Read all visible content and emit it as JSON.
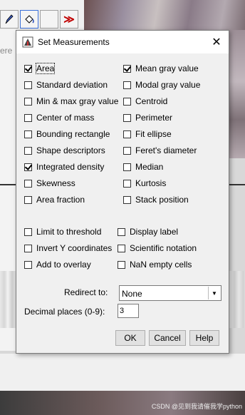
{
  "background": {
    "toolbar_tools": [
      {
        "icon": "pencil-icon"
      },
      {
        "icon": "bucket-icon"
      },
      {
        "icon": "blank-tool-icon"
      },
      {
        "icon": "double-chevron-right-icon",
        "label": "≫"
      }
    ],
    "left_partial_text": "ere ·",
    "watermark": "CSDN @见到我请催我学python"
  },
  "dialog": {
    "title": "Set Measurements",
    "close_glyph": "✕",
    "measurements_left": [
      {
        "label": "Area",
        "checked": true
      },
      {
        "label": "Standard deviation",
        "checked": false
      },
      {
        "label": "Min & max gray value",
        "checked": false
      },
      {
        "label": "Center of mass",
        "checked": false
      },
      {
        "label": "Bounding rectangle",
        "checked": false
      },
      {
        "label": "Shape descriptors",
        "checked": false
      },
      {
        "label": "Integrated density",
        "checked": true
      },
      {
        "label": "Skewness",
        "checked": false
      },
      {
        "label": "Area fraction",
        "checked": false
      }
    ],
    "measurements_right": [
      {
        "label": "Mean gray value",
        "checked": true
      },
      {
        "label": "Modal gray value",
        "checked": false
      },
      {
        "label": "Centroid",
        "checked": false
      },
      {
        "label": "Perimeter",
        "checked": false
      },
      {
        "label": "Fit ellipse",
        "checked": false
      },
      {
        "label": "Feret's diameter",
        "checked": false
      },
      {
        "label": "Median",
        "checked": false
      },
      {
        "label": "Kurtosis",
        "checked": false
      },
      {
        "label": "Stack position",
        "checked": false
      }
    ],
    "options_left": [
      {
        "label": "Limit to threshold",
        "checked": false
      },
      {
        "label": "Invert Y coordinates",
        "checked": false
      },
      {
        "label": "Add to overlay",
        "checked": false
      }
    ],
    "options_right": [
      {
        "label": "Display label",
        "checked": false
      },
      {
        "label": "Scientific notation",
        "checked": false
      },
      {
        "label": "NaN empty cells",
        "checked": false
      }
    ],
    "redirect_label": "Redirect to:",
    "redirect_value": "None",
    "decimal_label": "Decimal places (0-9):",
    "decimal_value": "3",
    "ok_label": "OK",
    "cancel_label": "Cancel",
    "help_label": "Help"
  }
}
